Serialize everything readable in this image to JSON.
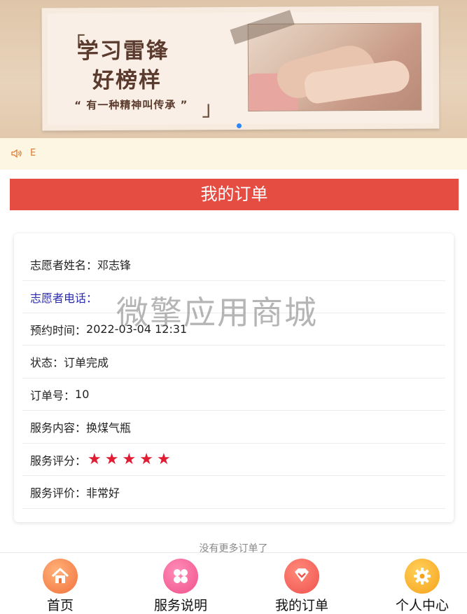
{
  "banner": {
    "title_line1": "学习雷锋",
    "title_line2": "好榜样",
    "subtitle": "“ 有一种精神叫传承 ”",
    "bracket_open": "「",
    "bracket_close": "」"
  },
  "notice": {
    "icon": "speaker-icon",
    "text": "E"
  },
  "header": {
    "title": "我的订单"
  },
  "order": {
    "name_label": "志愿者姓名：",
    "name_value": "邓志锋",
    "phone_label": "志愿者电话：",
    "phone_value": "",
    "time_label": "预约时间：",
    "time_value": "2022-03-04 12:31",
    "status_label": "状态：",
    "status_value": "订单完成",
    "order_no_label": "订单号：",
    "order_no_value": "10",
    "service_label": "服务内容：",
    "service_value": "换煤气瓶",
    "rating_label": "服务评分：",
    "rating_value": 5,
    "rating_max": 5,
    "review_label": "服务评价：",
    "review_value": "非常好"
  },
  "watermark": "微擎应用商城",
  "no_more": "没有更多订单了",
  "tabbar": {
    "items": [
      {
        "label": "首页",
        "icon": "home-icon",
        "color": "#f2703c"
      },
      {
        "label": "服务说明",
        "icon": "grid-icon",
        "color": "#f0518a"
      },
      {
        "label": "我的订单",
        "icon": "heart-icon",
        "color": "#f0524e"
      },
      {
        "label": "个人中心",
        "icon": "gear-icon",
        "color": "#f7a21b"
      }
    ]
  },
  "colors": {
    "header_bg": "#e54c42",
    "star": "#e01b32",
    "notice_bg": "#fdf6e2",
    "pager_dot": "#2f87f6"
  }
}
